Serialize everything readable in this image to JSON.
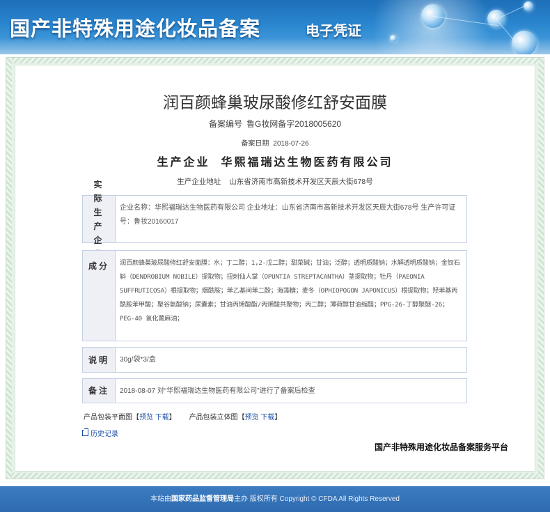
{
  "header": {
    "title": "国产非特殊用途化妆品备案",
    "subtitle": "电子凭证"
  },
  "product": {
    "name": "润百颜蜂巢玻尿酸修红舒安面膜",
    "registration_label": "备案编号",
    "registration_no": "鲁G妆网备字2018005620",
    "date_label": "备案日期",
    "date": "2018-07-26",
    "manufacturer_label": "生产企业",
    "manufacturer": "华熙福瑞达生物医药有限公司",
    "address_label": "生产企业地址",
    "address": "山东省济南市高新技术开发区天辰大街678号"
  },
  "sections": {
    "enterprise": {
      "label": "实际生产企业",
      "content": "企业名称：华熙福瑞达生物医药有限公司   企业地址：山东省济南市高新技术开发区天辰大街678号   生产许可证号：鲁妆20160017"
    },
    "ingredients": {
      "label": "成分",
      "content": "润百颜蜂巢玻尿酸修红舒安面膜：水；丁二醇；1,2-戊二醇；甜菜碱；甘油；泛醇；透明质酸钠；水解透明质酸钠；金钗石斛（DENDROBIUM NOBILE）提取物；扭刺仙人掌（OPUNTIA STREPTACANTHA）茎提取物；牡丹（PAEONIA SUFFRUTICOSA）根提取物；烟酰胺；苯乙基间苯二酚；海藻糖；麦冬（OPHIOPOGON JAPONICUS）根提取物；羟苯基丙酰胺苯甲酸；聚谷氨酸钠；尿囊素；甘油丙烯酸酯/丙烯酸共聚物；丙二醇；薄荷醇甘油缩醛；PPG-26-丁醇聚醚-26；PEG-40 氢化蓖麻油；"
    },
    "notes": {
      "label": "说明",
      "content": "30g/袋*3/盒"
    },
    "remarks": {
      "label": "备注",
      "content": "2018-08-07 对“华熙福瑞达生物医药有限公司”进行了备案后检查"
    }
  },
  "attachments": {
    "flat_label": "产品包装平面图",
    "stereo_label": "产品包装立体图",
    "preview": "预览",
    "download": "下载",
    "bracket_open": "【",
    "bracket_close": "】"
  },
  "history_link": "历史记录",
  "platform_name": "国产非特殊用途化妆品备案服务平台",
  "footer": {
    "prefix": "本站由",
    "org": "国家药品监督管理局",
    "suffix": "主办 版权所有 Copyright © CFDA All Rights Reserved"
  }
}
